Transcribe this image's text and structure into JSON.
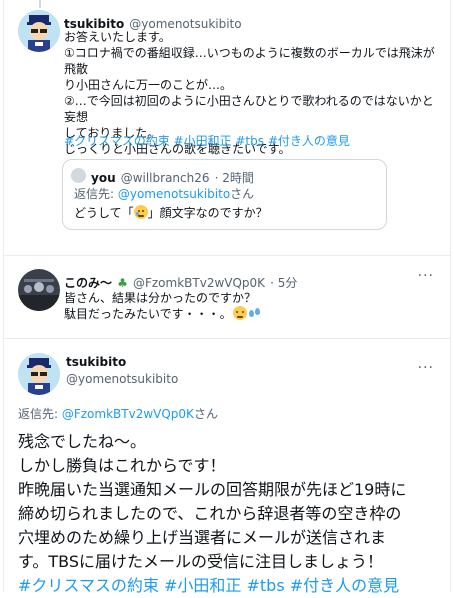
{
  "tweet1": {
    "name": "tsukibito",
    "handle": "@yomenotsukibito",
    "lines": [
      "お答えいたします。",
      "①コロナ禍での番組収録…いつものように複数のボーカルでは飛沫が飛散",
      "り小田さんに万一のことが…。",
      "②…で今回は初回のように小田さんひとりで歌われるのではないかと妄想",
      "しておりました。",
      "じっくりと小田さんの歌を聴きたいです。"
    ],
    "hashtags": "#クリスマスの約束 #小田和正 #tbs #付き人の意見"
  },
  "quote": {
    "name": "you",
    "handle": "@willbranch26",
    "time": "· 2時間",
    "reply_prefix": "返信先: ",
    "reply_to": "@yomenotsukibito",
    "reply_suffix": "さん",
    "text_before": "どうして「",
    "text_after": "」顔文字なのですか？"
  },
  "tweet2": {
    "name": "このみ〜",
    "handle": "@FzomkBTv2wVQp0K",
    "time": "· 5分",
    "line1": "皆さん、結果は分かったのですか？",
    "line2": "駄目だったみたいです・・・。"
  },
  "tweet3": {
    "name": "tsukibito",
    "handle": "@yomenotsukibito",
    "reply_prefix": "返信先: ",
    "reply_to": "@FzomkBTv2wVQp0K",
    "reply_suffix": "さん",
    "lines": [
      "残念でしたね〜。",
      "しかし勝負はこれからです！",
      "昨晩届いた当選通知メールの回答期限が先ほど19時に",
      "締め切られましたので、これから辞退者等の空き枠の",
      "穴埋めのため繰り上げ当選者にメールが送信されま",
      "す。TBSに届けたメールの受信に注目しましょう！"
    ],
    "hashtags": "#クリスマスの約束 #小田和正 #tbs #付き人の意見"
  },
  "icons": {
    "more": "more-icon",
    "clover": "clover-icon"
  },
  "colors": {
    "link": "#1d9bf0",
    "thread": "#cfd9de"
  }
}
